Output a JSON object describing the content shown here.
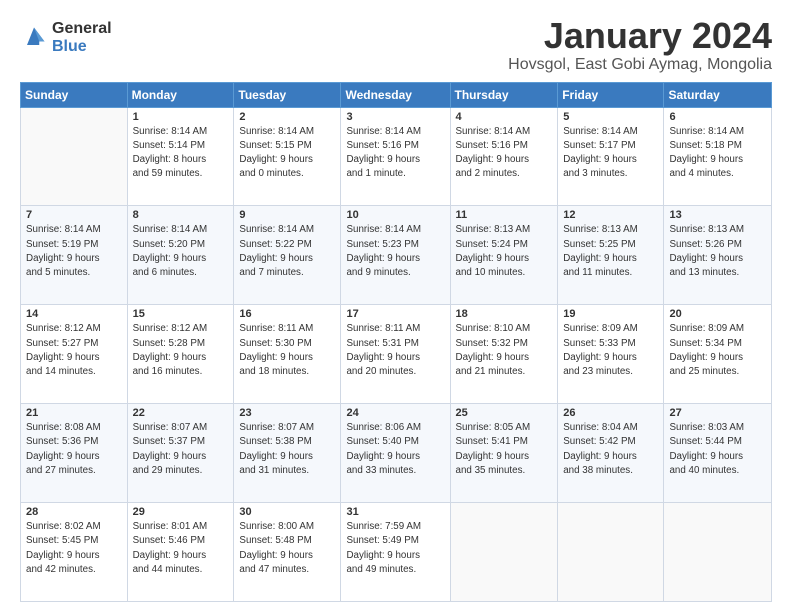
{
  "logo": {
    "general": "General",
    "blue": "Blue"
  },
  "title": "January 2024",
  "subtitle": "Hovsgol, East Gobi Aymag, Mongolia",
  "days_of_week": [
    "Sunday",
    "Monday",
    "Tuesday",
    "Wednesday",
    "Thursday",
    "Friday",
    "Saturday"
  ],
  "weeks": [
    [
      {
        "day": "",
        "info": ""
      },
      {
        "day": "1",
        "info": "Sunrise: 8:14 AM\nSunset: 5:14 PM\nDaylight: 8 hours\nand 59 minutes."
      },
      {
        "day": "2",
        "info": "Sunrise: 8:14 AM\nSunset: 5:15 PM\nDaylight: 9 hours\nand 0 minutes."
      },
      {
        "day": "3",
        "info": "Sunrise: 8:14 AM\nSunset: 5:16 PM\nDaylight: 9 hours\nand 1 minute."
      },
      {
        "day": "4",
        "info": "Sunrise: 8:14 AM\nSunset: 5:16 PM\nDaylight: 9 hours\nand 2 minutes."
      },
      {
        "day": "5",
        "info": "Sunrise: 8:14 AM\nSunset: 5:17 PM\nDaylight: 9 hours\nand 3 minutes."
      },
      {
        "day": "6",
        "info": "Sunrise: 8:14 AM\nSunset: 5:18 PM\nDaylight: 9 hours\nand 4 minutes."
      }
    ],
    [
      {
        "day": "7",
        "info": "Sunrise: 8:14 AM\nSunset: 5:19 PM\nDaylight: 9 hours\nand 5 minutes."
      },
      {
        "day": "8",
        "info": "Sunrise: 8:14 AM\nSunset: 5:20 PM\nDaylight: 9 hours\nand 6 minutes."
      },
      {
        "day": "9",
        "info": "Sunrise: 8:14 AM\nSunset: 5:22 PM\nDaylight: 9 hours\nand 7 minutes."
      },
      {
        "day": "10",
        "info": "Sunrise: 8:14 AM\nSunset: 5:23 PM\nDaylight: 9 hours\nand 9 minutes."
      },
      {
        "day": "11",
        "info": "Sunrise: 8:13 AM\nSunset: 5:24 PM\nDaylight: 9 hours\nand 10 minutes."
      },
      {
        "day": "12",
        "info": "Sunrise: 8:13 AM\nSunset: 5:25 PM\nDaylight: 9 hours\nand 11 minutes."
      },
      {
        "day": "13",
        "info": "Sunrise: 8:13 AM\nSunset: 5:26 PM\nDaylight: 9 hours\nand 13 minutes."
      }
    ],
    [
      {
        "day": "14",
        "info": "Sunrise: 8:12 AM\nSunset: 5:27 PM\nDaylight: 9 hours\nand 14 minutes."
      },
      {
        "day": "15",
        "info": "Sunrise: 8:12 AM\nSunset: 5:28 PM\nDaylight: 9 hours\nand 16 minutes."
      },
      {
        "day": "16",
        "info": "Sunrise: 8:11 AM\nSunset: 5:30 PM\nDaylight: 9 hours\nand 18 minutes."
      },
      {
        "day": "17",
        "info": "Sunrise: 8:11 AM\nSunset: 5:31 PM\nDaylight: 9 hours\nand 20 minutes."
      },
      {
        "day": "18",
        "info": "Sunrise: 8:10 AM\nSunset: 5:32 PM\nDaylight: 9 hours\nand 21 minutes."
      },
      {
        "day": "19",
        "info": "Sunrise: 8:09 AM\nSunset: 5:33 PM\nDaylight: 9 hours\nand 23 minutes."
      },
      {
        "day": "20",
        "info": "Sunrise: 8:09 AM\nSunset: 5:34 PM\nDaylight: 9 hours\nand 25 minutes."
      }
    ],
    [
      {
        "day": "21",
        "info": "Sunrise: 8:08 AM\nSunset: 5:36 PM\nDaylight: 9 hours\nand 27 minutes."
      },
      {
        "day": "22",
        "info": "Sunrise: 8:07 AM\nSunset: 5:37 PM\nDaylight: 9 hours\nand 29 minutes."
      },
      {
        "day": "23",
        "info": "Sunrise: 8:07 AM\nSunset: 5:38 PM\nDaylight: 9 hours\nand 31 minutes."
      },
      {
        "day": "24",
        "info": "Sunrise: 8:06 AM\nSunset: 5:40 PM\nDaylight: 9 hours\nand 33 minutes."
      },
      {
        "day": "25",
        "info": "Sunrise: 8:05 AM\nSunset: 5:41 PM\nDaylight: 9 hours\nand 35 minutes."
      },
      {
        "day": "26",
        "info": "Sunrise: 8:04 AM\nSunset: 5:42 PM\nDaylight: 9 hours\nand 38 minutes."
      },
      {
        "day": "27",
        "info": "Sunrise: 8:03 AM\nSunset: 5:44 PM\nDaylight: 9 hours\nand 40 minutes."
      }
    ],
    [
      {
        "day": "28",
        "info": "Sunrise: 8:02 AM\nSunset: 5:45 PM\nDaylight: 9 hours\nand 42 minutes."
      },
      {
        "day": "29",
        "info": "Sunrise: 8:01 AM\nSunset: 5:46 PM\nDaylight: 9 hours\nand 44 minutes."
      },
      {
        "day": "30",
        "info": "Sunrise: 8:00 AM\nSunset: 5:48 PM\nDaylight: 9 hours\nand 47 minutes."
      },
      {
        "day": "31",
        "info": "Sunrise: 7:59 AM\nSunset: 5:49 PM\nDaylight: 9 hours\nand 49 minutes."
      },
      {
        "day": "",
        "info": ""
      },
      {
        "day": "",
        "info": ""
      },
      {
        "day": "",
        "info": ""
      }
    ]
  ]
}
